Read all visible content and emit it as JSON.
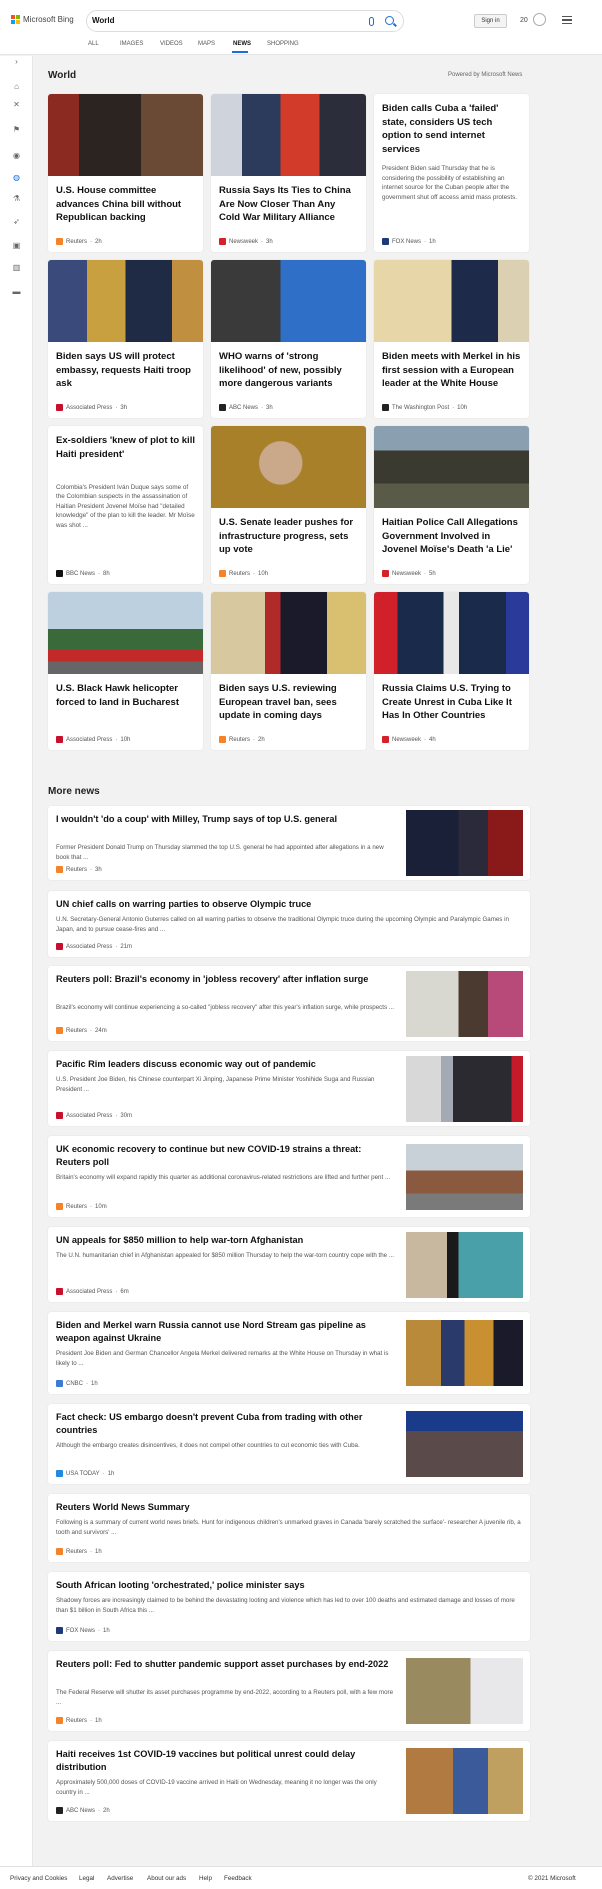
{
  "header": {
    "logo_text": "Microsoft Bing",
    "search_value": "World",
    "signin_label": "Sign in",
    "rewards_count": "20",
    "tabs": [
      {
        "label": "ALL",
        "active": false
      },
      {
        "label": "IMAGES",
        "active": false
      },
      {
        "label": "VIDEOS",
        "active": false
      },
      {
        "label": "MAPS",
        "active": false
      },
      {
        "label": "NEWS",
        "active": true
      },
      {
        "label": "SHOPPING",
        "active": false
      }
    ]
  },
  "rail_icons": [
    "expand-icon",
    "home-icon",
    "discover-icon",
    "flag-icon",
    "location-icon",
    "world-icon",
    "science-icon",
    "rocket-icon",
    "entertainment-icon",
    "money-icon",
    "card-icon"
  ],
  "section": {
    "title": "World",
    "powered_by": "Powered by Microsoft News"
  },
  "cards": [
    {
      "title": "U.S. House committee advances China bill without Republican backing",
      "source": "Reuters",
      "time": "2h",
      "image": "congress-photo"
    },
    {
      "title": "Russia Says Its Ties to China Are Now Closer Than Any Cold War Military Alliance",
      "source": "Newsweek",
      "time": "3h",
      "image": "diplomats-photo"
    },
    {
      "title": "Biden calls Cuba a 'failed' state, considers US tech option to send internet services",
      "desc": "President Biden said Thursday that he is considering the possibility of establishing an internet source for the Cuban people after the government shut off access amid mass protests.",
      "source": "FOX News",
      "time": "1h",
      "image": ""
    },
    {
      "title": "Biden says US will protect embassy, requests Haiti troop ask",
      "source": "Associated Press",
      "time": "3h",
      "image": "biden-flags-photo"
    },
    {
      "title": "WHO warns of 'strong likelihood' of new, possibly more dangerous variants",
      "source": "ABC News",
      "time": "3h",
      "image": "who-photo"
    },
    {
      "title": "Biden meets with Merkel in his first session with a European leader at the White House",
      "source": "The Washington Post",
      "time": "10h",
      "image": "merkel-harris-photo"
    },
    {
      "title": "Ex-soldiers 'knew of plot to kill Haiti president'",
      "desc": "Colombia's President Iván Duque says some of the Colombian suspects in the assassination of Haitian President Jovenel Moïse had \"detailed knowledge\" of the plan to kill the leader. Mr Moïse was shot ...",
      "source": "BBC News",
      "time": "8h",
      "image": ""
    },
    {
      "title": "U.S. Senate leader pushes for infrastructure progress, sets up vote",
      "source": "Reuters",
      "time": "10h",
      "image": "senator-photo"
    },
    {
      "title": "Haitian Police Call Allegations Government Involved in Jovenel Moïse's Death 'a Lie'",
      "source": "Newsweek",
      "time": "5h",
      "image": "haiti-crowd-photo"
    },
    {
      "title": "U.S. Black Hawk helicopter forced to land in Bucharest",
      "source": "Associated Press",
      "time": "10h",
      "image": "firetruck-photo"
    },
    {
      "title": "Biden says U.S. reviewing European travel ban, sees update in coming days",
      "source": "Reuters",
      "time": "2h",
      "image": "east-room-photo"
    },
    {
      "title": "Russia Claims U.S. Trying to Create Unrest in Cuba Like It Has In Other Countries",
      "source": "Newsweek",
      "time": "4h",
      "image": "putin-photo"
    }
  ],
  "more_news": {
    "title": "More news",
    "items": [
      {
        "title": "I wouldn't 'do a coup' with Milley, Trump says of top U.S. general",
        "desc": "Former President Donald Trump on Thursday slammed the top U.S. general he had appointed after allegations in a new book that ...",
        "source": "Reuters",
        "time": "3h",
        "image": "trump-milley-photo"
      },
      {
        "title": "UN chief calls on warring parties to observe Olympic truce",
        "desc": "U.N. Secretary-General Antonio Guterres called on all warring parties to observe the traditional Olympic truce during the upcoming Olympic and Paralympic Games in Japan, and to pursue cease-fires and ...",
        "source": "Associated Press",
        "time": "21m",
        "image": ""
      },
      {
        "title": "Reuters poll: Brazil's economy in 'jobless recovery' after inflation surge",
        "desc": "Brazil's economy will continue experiencing a so-called \"jobless recovery\" after this year's inflation surge, while prospects ...",
        "source": "Reuters",
        "time": "24m",
        "image": "brazil-street-photo"
      },
      {
        "title": "Pacific Rim leaders discuss economic way out of pandemic",
        "desc": "U.S. President Joe Biden, his Chinese counterpart Xi Jinping, Japanese Prime Minister Yoshihide Suga and Russian President ...",
        "source": "Associated Press",
        "time": "30m",
        "image": "video-call-photo"
      },
      {
        "title": "UK economic recovery to continue but new COVID-19 strains a threat: Reuters poll",
        "desc": "Britain's economy will expand rapidly this quarter as additional coronavirus-related restrictions are lifted and further pent ...",
        "source": "Reuters",
        "time": "10m",
        "image": "uk-street-photo"
      },
      {
        "title": "UN appeals for $850 million to help war-torn Afghanistan",
        "desc": "The U.N. humanitarian chief in Afghanistan appealed for $850 million Thursday to help the war-torn country cope with the ...",
        "source": "Associated Press",
        "time": "6m",
        "image": "afghan-photo"
      },
      {
        "title": "Biden and Merkel warn Russia cannot use Nord Stream gas pipeline as weapon against Ukraine",
        "desc": "President Joe Biden and German Chancellor Angela Merkel delivered remarks at the White House on Thursday in what is likely to ...",
        "source": "CNBC",
        "time": "1h",
        "image": "biden-merkel-photo"
      },
      {
        "title": "Fact check: US embargo doesn't prevent Cuba from trading with other countries",
        "desc": "Although the embargo creates disincentives, it does not compel other countries to cut economic ties with Cuba.",
        "source": "USA TODAY",
        "time": "1h",
        "image": "cuba-crowd-photo"
      },
      {
        "title": "Reuters World News Summary",
        "desc": "Following is a summary of current world news briefs. Hunt for indigenous children's unmarked graves in Canada 'barely scratched the surface'- researcher A juvenile rib, a tooth and survivors' ...",
        "source": "Reuters",
        "time": "1h",
        "image": ""
      },
      {
        "title": "South African looting 'orchestrated,' police minister says",
        "desc": "Shadowy forces are increasingly claimed to be behind the devastating looting and violence which has led to over 100 deaths and estimated damage and losses of more than $1 billion in South Africa this ...",
        "source": "FOX News",
        "time": "1h",
        "image": ""
      },
      {
        "title": "Reuters poll: Fed to shutter pandemic support asset purchases by end-2022",
        "desc": "The Federal Reserve will shutter its asset purchases programme by end-2022, according to a Reuters poll, with a few more ...",
        "source": "Reuters",
        "time": "1h",
        "image": "dollar-chart-photo"
      },
      {
        "title": "Haiti receives 1st COVID-19 vaccines but political unrest could delay distribution",
        "desc": "Approximately 500,000 doses of COVID-19 vaccine arrived in Haiti on Wednesday, meaning it no longer was the only country in ...",
        "source": "ABC News",
        "time": "2h",
        "image": "vaccine-boxes-photo"
      }
    ]
  },
  "source_colors": {
    "Reuters": "#f5832a",
    "Newsweek": "#d6202a",
    "FOX News": "#1d3a7a",
    "Associated Press": "#c8102e",
    "ABC News": "#222222",
    "The Washington Post": "#222222",
    "BBC News": "#111111",
    "CNBC": "#3c7ad6",
    "USA TODAY": "#1f8ae0"
  },
  "footer": {
    "links": [
      "Privacy and Cookies",
      "Legal",
      "Advertise",
      "About our ads",
      "Help",
      "Feedback"
    ],
    "copyright": "© 2021 Microsoft"
  }
}
